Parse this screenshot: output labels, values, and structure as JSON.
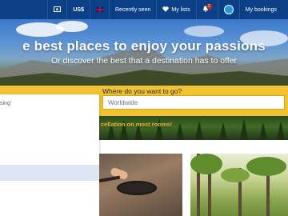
{
  "nav": {
    "items": [
      {
        "id": "currency-icon",
        "label": "",
        "icon": "currency-icon"
      },
      {
        "id": "currency",
        "label": "US$"
      },
      {
        "id": "language",
        "label": "",
        "icon": "uk-flag-icon"
      },
      {
        "id": "recently-seen",
        "label": "Recently seen"
      },
      {
        "id": "my-lists",
        "label": "My lists",
        "icon": "heart-icon"
      },
      {
        "id": "notifications",
        "label": "",
        "icon": "bell-icon",
        "badge": "2"
      },
      {
        "id": "chat",
        "label": "",
        "icon": "chat-bubble-icon"
      },
      {
        "id": "my-bookings",
        "label": "My bookings"
      }
    ]
  },
  "hero": {
    "title": "e best places to enjoy your passions",
    "subtitle": "Or discover the best that a destination has to offer"
  },
  "search": {
    "label": "Where do you want to go?",
    "placeholder": "Worldwide"
  },
  "left_panel": {
    "text": "sing'"
  },
  "promo": {
    "text": "cellation on most rooms!"
  },
  "colors": {
    "nav_bg": "#0b3f86",
    "accent_yellow": "#f2c230",
    "badge_red": "#d0201c"
  }
}
